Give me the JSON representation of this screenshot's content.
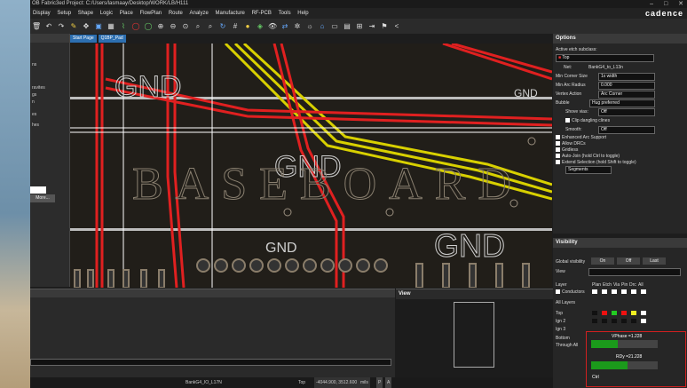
{
  "window": {
    "title": "OB Fabric3ed  Project: C:/Users/lasmaay/Desktop/WORK/LB/H111",
    "controls": [
      "–",
      "□",
      "✕"
    ],
    "brand": "cadence"
  },
  "menu": [
    "Display",
    "Setup",
    "Shape",
    "Logic",
    "Place",
    "FlowPlan",
    "Route",
    "Analyze",
    "Manufacture",
    "RF-PCB",
    "Tools",
    "Help"
  ],
  "tabs": [
    "Start Page",
    "Q1BP_Pad"
  ],
  "left_pane": {
    "labels": [
      "ns",
      "ravites",
      "gs",
      "n",
      "",
      "es",
      "hes"
    ],
    "more_label": "More..."
  },
  "canvas": {
    "labels": [
      "GND",
      "GND",
      "GND",
      "GND",
      "GND"
    ],
    "watermark": "BASEBOARD"
  },
  "options": {
    "title": "Options",
    "active_subclass_label": "Active etch subclass:",
    "active_subclass_value": "Top",
    "net_label": "Net:",
    "net_value": "BankG4_to_L13n",
    "min_corner_size_label": "Min Corner Size",
    "min_corner_size_value": "1x width",
    "min_arc_radius_label": "Min Arc Radius",
    "min_arc_radius_value": "0.000",
    "vertex_action_label": "Vertex Action",
    "vertex_action_value": "Arc Corner",
    "bubble_label": "Bubble",
    "bubble_value": "Hug preferred",
    "shove_vias_label": "Shove vias:",
    "shove_vias_value": "Off",
    "clip_dangling_label": "Clip dangling clines",
    "smooth_label": "Smooth:",
    "smooth_value": "Off",
    "checks": [
      "Enhanced Arc Support",
      "Allow DRCs",
      "Gridless",
      "Auto-Join (hold Ctrl to toggle)",
      "Extend Selection (hold Shift to toggle)"
    ],
    "segments_value": "Segments"
  },
  "visibility": {
    "title": "Visibility",
    "global_label": "Global visibility",
    "buttons": [
      "On",
      "Off",
      "Last"
    ],
    "view_label": "View",
    "layer_header": "Layer",
    "col_headers": [
      "Plan",
      "Etch",
      "Via",
      "Pin",
      "Drc",
      "All"
    ],
    "rows": [
      "Conductors",
      "All Layers",
      "Top",
      "Ign 2",
      "Ign 3"
    ],
    "bottom_label": "Bottom",
    "through_label": "Through All",
    "vphase_label": "VPhase =1.228",
    "vphase_value": 0.4,
    "rdy_label": "RDy =21.228",
    "rdy_value": 0.55,
    "ctrl_label": "Ctrl"
  },
  "view_panel": {
    "title": "View"
  },
  "status": {
    "net": "BankG4_IO_L17N",
    "layer": "Top",
    "coords": "-4044.900, 3512.600",
    "units": "mils",
    "buttons": [
      "P",
      "A"
    ]
  }
}
